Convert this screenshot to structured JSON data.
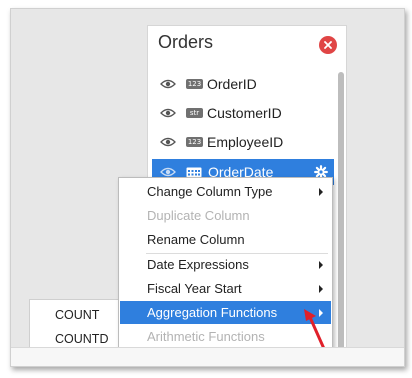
{
  "panel": {
    "title": "Orders",
    "columns": [
      {
        "badge": "123",
        "label": "OrderID"
      },
      {
        "badge": "str",
        "label": "CustomerID"
      },
      {
        "badge": "123",
        "label": "EmployeeID"
      },
      {
        "badge": "",
        "label": "OrderDate",
        "selected": true
      }
    ]
  },
  "context_menu": {
    "items": [
      {
        "label": "Change Column Type",
        "submenu": true
      },
      {
        "label": "Duplicate Column",
        "disabled": true
      },
      {
        "label": "Rename Column"
      },
      {
        "label": "Date Expressions",
        "submenu": true
      },
      {
        "label": "Fiscal Year Start",
        "submenu": true
      },
      {
        "label": "Aggregation Functions",
        "submenu": true,
        "highlighted": true
      },
      {
        "label": "Arithmetic Functions",
        "disabled": true
      }
    ]
  },
  "submenu": {
    "items": [
      "COUNT",
      "COUNTD"
    ]
  },
  "colors": {
    "accent": "#2f7fde",
    "close": "#e04545",
    "pointer_arrow": "#e0202a"
  }
}
